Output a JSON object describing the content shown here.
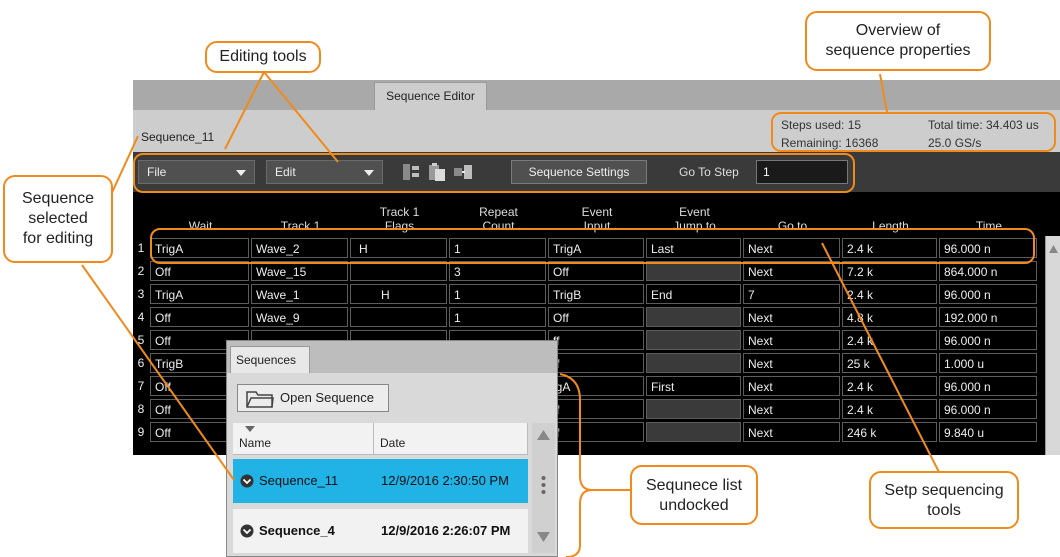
{
  "annotations": {
    "editing_tools": "Editing tools",
    "overview_line1": "Overview of",
    "overview_line2": "sequence properties",
    "sequence_selected_line1": "Sequence",
    "sequence_selected_line2": "selected",
    "sequence_selected_line3": "for editing",
    "list_undocked_line1": "Sequnece list",
    "list_undocked_line2": "undocked",
    "step_tools_line1": "Setp sequencing",
    "step_tools_line2": "tools"
  },
  "editor": {
    "tab_label": "Sequence Editor",
    "sequence_name": "Sequence_11",
    "steps_used": "Steps used: 15",
    "remaining": "Remaining: 16368",
    "total_time": "Total time: 34.403 us",
    "sample_rate": "25.0 GS/s"
  },
  "toolbar": {
    "file_label": "File",
    "edit_label": "Edit",
    "settings_label": "Sequence Settings",
    "goto_label": "Go To Step",
    "goto_value": "1"
  },
  "grid": {
    "headers": [
      [
        "",
        "Wait"
      ],
      [
        "",
        "Track 1"
      ],
      [
        "Track 1",
        "Flags"
      ],
      [
        "Repeat",
        "Count"
      ],
      [
        "Event",
        "Input"
      ],
      [
        "Event",
        "Jump to"
      ],
      [
        "",
        "Go to"
      ],
      [
        "",
        "Length"
      ],
      [
        "",
        "Time"
      ]
    ],
    "rows": [
      {
        "n": "1",
        "cells": [
          "TrigA",
          "Wave_2",
          "H",
          "1",
          "TrigA",
          "Last",
          "Next",
          "2.4 k",
          "96.000 n"
        ]
      },
      {
        "n": "2",
        "cells": [
          "Off",
          "Wave_15",
          "",
          "3",
          "Off",
          "",
          "Next",
          "7.2 k",
          "864.000 n"
        ]
      },
      {
        "n": "3",
        "cells": [
          "TrigA",
          "Wave_1",
          "H",
          "1",
          "TrigB",
          "End",
          "7",
          "2.4 k",
          "96.000 n"
        ]
      },
      {
        "n": "4",
        "cells": [
          "Off",
          "Wave_9",
          "",
          "1",
          "Off",
          "",
          "Next",
          "4.8 k",
          "192.000 n"
        ]
      },
      {
        "n": "5",
        "cells": [
          "Off",
          "",
          "",
          "",
          "ff",
          "",
          "Next",
          "2.4 k",
          "96.000 n"
        ]
      },
      {
        "n": "6",
        "cells": [
          "TrigB",
          "",
          "",
          "",
          "ff",
          "",
          "Next",
          "25 k",
          "1.000 u"
        ]
      },
      {
        "n": "7",
        "cells": [
          "Off",
          "",
          "",
          "",
          "igA",
          "First",
          "Next",
          "2.4 k",
          "96.000 n"
        ]
      },
      {
        "n": "8",
        "cells": [
          "Off",
          "",
          "",
          "",
          "ff",
          "",
          "Next",
          "2.4 k",
          "96.000 n"
        ]
      },
      {
        "n": "9",
        "cells": [
          "Off",
          "",
          "",
          "",
          "ff",
          "",
          "Next",
          "246 k",
          "9.840 u"
        ]
      }
    ]
  },
  "sequences_panel": {
    "tab_label": "Sequences",
    "open_button": "Open Sequence",
    "col_name": "Name",
    "col_date": "Date",
    "items": [
      {
        "name": "Sequence_11",
        "date": "12/9/2016 2:30:50 PM"
      },
      {
        "name": "Sequence_4",
        "date": "12/9/2016 2:26:07 PM"
      }
    ]
  },
  "colors": {
    "annotation": "#f08a1c",
    "selection": "#21b2e6"
  }
}
